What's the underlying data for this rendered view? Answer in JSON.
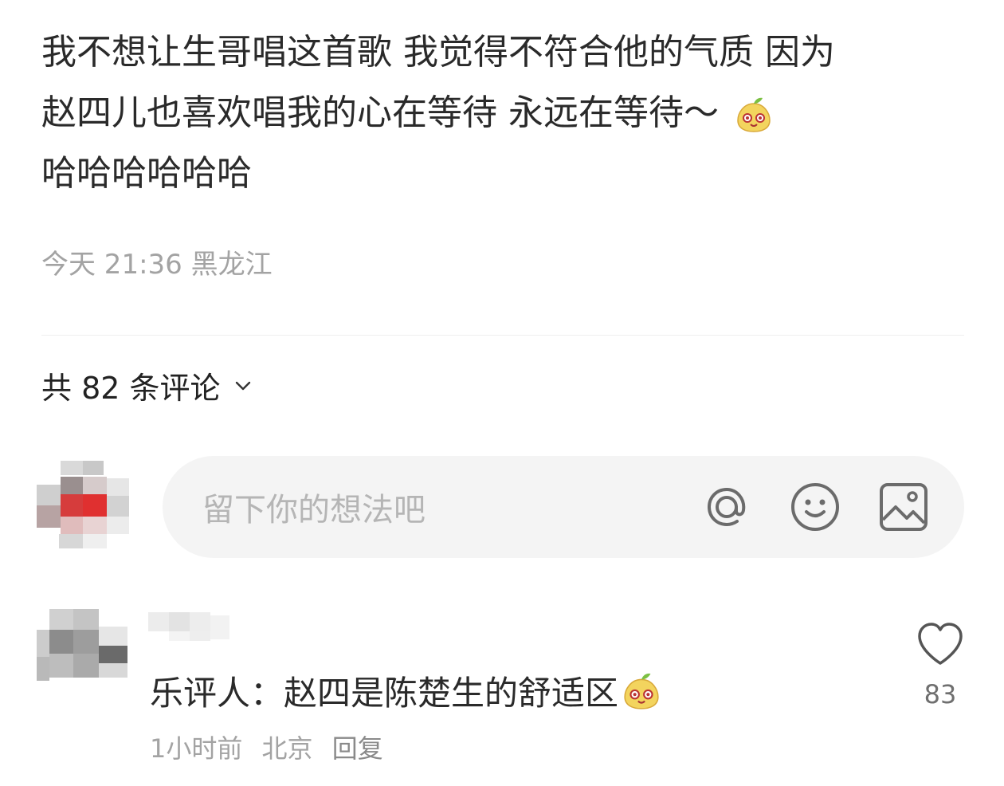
{
  "post": {
    "line1": "我不想让生哥唱这首歌 我觉得不符合他的气质 因为",
    "line2": "赵四儿也喜欢唱我的心在等待 永远在等待～",
    "line3": "哈哈哈哈哈哈",
    "emoji": "pear-face-emoji"
  },
  "meta": {
    "time": "今天 21:36",
    "location": "黑龙江"
  },
  "comments_header": {
    "label": "共 82 条评论",
    "icon": "chevron-down-icon"
  },
  "input": {
    "placeholder": "留下你的想法吧",
    "icons": [
      "at-icon",
      "smile-icon",
      "image-icon"
    ]
  },
  "comments": [
    {
      "avatar": "blurred",
      "name": "blurred",
      "text": "乐评人：赵四是陈楚生的舒适区",
      "emoji": "pear-face-emoji",
      "time": "1小时前",
      "location": "北京",
      "reply_label": "回复",
      "likes": "83"
    }
  ],
  "colors": {
    "meta": "#a3a3a3",
    "input_bg": "#f4f4f4",
    "emoji_face": "#f3d45e",
    "emoji_leaf": "#7cc043"
  }
}
